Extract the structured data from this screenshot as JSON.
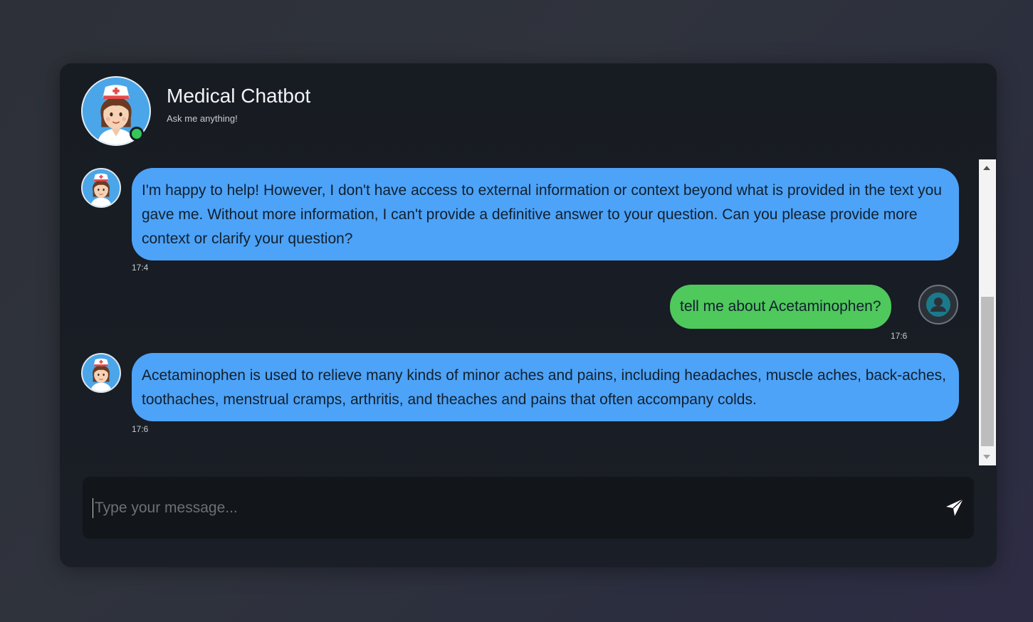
{
  "header": {
    "title": "Medical Chatbot",
    "subtitle": "Ask me anything!",
    "avatar_icon": "nurse-avatar-icon",
    "status": "online"
  },
  "messages": [
    {
      "sender": "bot",
      "text": "I'm happy to help! However, I don't have access to external information or context beyond what is provided in the text you gave me. Without more information, I can't provide a definitive answer to your question. Can you please provide more context or clarify your question?",
      "time": "17:4"
    },
    {
      "sender": "user",
      "text": "tell me about Acetaminophen?",
      "time": "17:6"
    },
    {
      "sender": "bot",
      "text": "Acetaminophen is used to relieve many kinds of minor aches and pains, including headaches, muscle aches, back-aches, toothaches, menstrual cramps, arthritis, and theaches and pains that often accompany colds.",
      "time": "17:6"
    }
  ],
  "input": {
    "placeholder": "Type your message...",
    "value": "",
    "send_icon": "paper-plane-icon"
  },
  "colors": {
    "bot_bubble": "#4da3f8",
    "user_bubble": "#4fc85c",
    "online": "#34c759",
    "panel": "#171b22"
  }
}
